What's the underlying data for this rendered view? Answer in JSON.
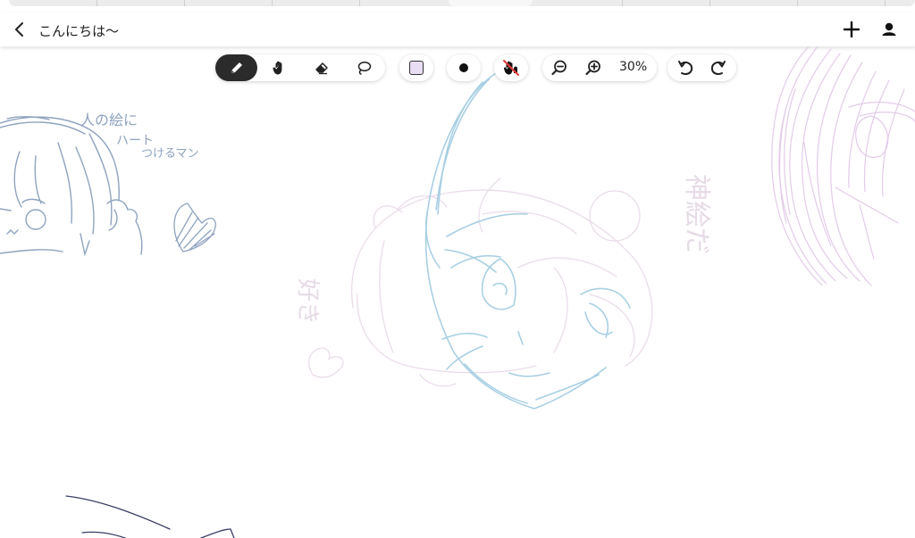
{
  "header": {
    "title": "こんにちは〜",
    "back_icon": "chevron-left-icon",
    "add_icon": "plus-icon",
    "user_icon": "person-icon"
  },
  "toolbar": {
    "tools": [
      {
        "name": "pen",
        "icon": "pen-icon",
        "active": true
      },
      {
        "name": "hand",
        "icon": "hand-icon",
        "active": false
      },
      {
        "name": "eraser",
        "icon": "eraser-icon",
        "active": false
      },
      {
        "name": "lasso",
        "icon": "lasso-icon",
        "active": false
      }
    ],
    "color": {
      "value": "#e9ddf3",
      "icon": "color-swatch"
    },
    "brush_size": {
      "icon": "dot-icon"
    },
    "palm_rejection": {
      "icon": "hand-off-icon",
      "accent": "#e53935"
    },
    "zoom": {
      "out_icon": "zoom-out-icon",
      "in_icon": "zoom-in-icon",
      "level": "30%"
    },
    "history": {
      "undo_icon": "undo-icon",
      "redo_icon": "redo-icon"
    }
  },
  "canvas": {
    "annotations": {
      "note_line1": "人の絵に",
      "note_line2": "ハート",
      "note_line3": "つけるマン",
      "left_text": "好き",
      "right_text": "神絵だ"
    },
    "colors": {
      "slate": "#8fa3bf",
      "light_blue": "#a9cfe3",
      "light_pink": "#eadcea",
      "lavender": "#e3cbe9",
      "navy": "#3b3f66"
    }
  }
}
